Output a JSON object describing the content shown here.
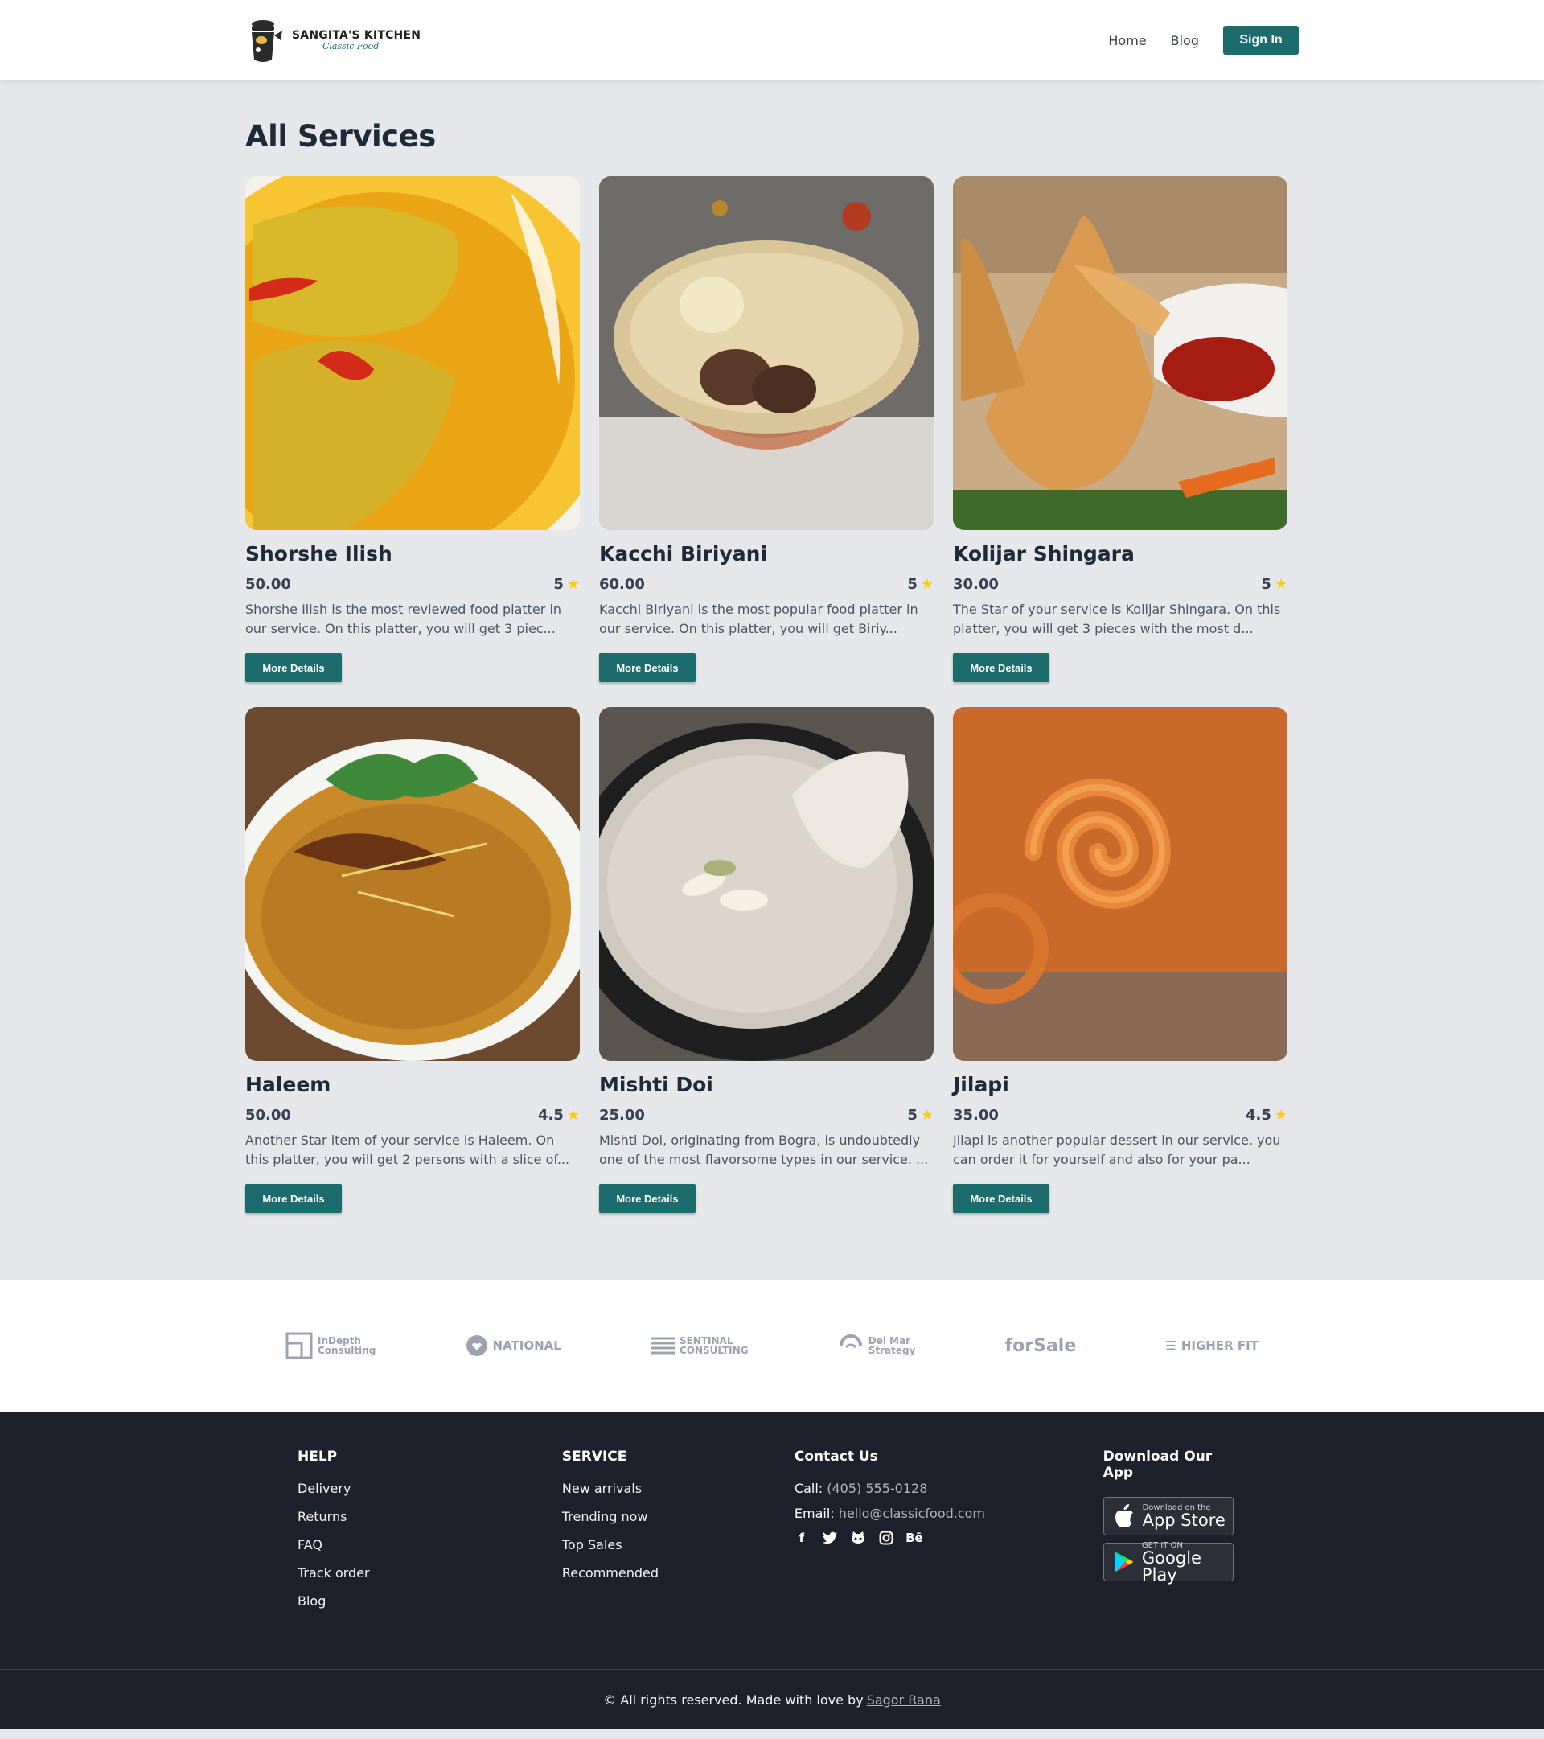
{
  "brand": {
    "name": "SANGITA'S KITCHEN",
    "tagline": "Classic Food"
  },
  "nav": {
    "home": "Home",
    "blog": "Blog",
    "sign_in": "Sign In"
  },
  "page_title": "All Services",
  "services": [
    {
      "title": "Shorshe Ilish",
      "price": "50.00",
      "rating": "5",
      "desc": "Shorshe Ilish is the most reviewed food platter in our service. On this platter, you will get 3 piec...",
      "button": "More Details"
    },
    {
      "title": "Kacchi Biriyani",
      "price": "60.00",
      "rating": "5",
      "desc": "Kacchi Biriyani is the most popular food platter in our service. On this platter, you will get Biriy...",
      "button": "More Details"
    },
    {
      "title": "Kolijar Shingara",
      "price": "30.00",
      "rating": "5",
      "desc": "The Star of your service is Kolijar Shingara. On this platter, you will get 3 pieces with the most d...",
      "button": "More Details"
    },
    {
      "title": "Haleem",
      "price": "50.00",
      "rating": "4.5",
      "desc": "Another Star item of your service is Haleem. On this platter, you will get 2 persons with a slice of...",
      "button": "More Details"
    },
    {
      "title": "Mishti Doi",
      "price": "25.00",
      "rating": "5",
      "desc": "Mishti Doi, originating from Bogra, is undoubtedly one of the most flavorsome types in our service. ...",
      "button": "More Details"
    },
    {
      "title": "Jilapi",
      "price": "35.00",
      "rating": "4.5",
      "desc": "Jilapi is another popular dessert in our service. you can order it for yourself and also for your pa...",
      "button": "More Details"
    }
  ],
  "partners": {
    "indepth": [
      "InDepth",
      "Consulting"
    ],
    "national": "NATIONAL",
    "sentinal": [
      "SENTINAL",
      "CONSULTING"
    ],
    "delmar": [
      "Del Mar",
      "Strategy"
    ],
    "forsale": "forSale",
    "higherfit": "HIGHER FIT"
  },
  "footer": {
    "help_title": "HELP",
    "help_links": [
      "Delivery",
      "Returns",
      "FAQ",
      "Track order",
      "Blog"
    ],
    "service_title": "SERVICE",
    "service_links": [
      "New arrivals",
      "Trending now",
      "Top Sales",
      "Recommended"
    ],
    "contact_title": "Contact Us",
    "call_label": "Call:",
    "call_value": "(405) 555-0128",
    "email_label": "Email:",
    "email_value": "hello@classicfood.com",
    "behance": "Bē",
    "app_title": "Download Our App",
    "appstore_small": "Download on the",
    "appstore_big": "App Store",
    "googleplay_small": "GET IT ON",
    "googleplay_big": "Google Play",
    "copyright": "© All rights reserved. Made with love by",
    "author": "Sagor Rana"
  },
  "icons": [
    "chef-pot-logo-icon",
    "star-icon",
    "facebook-icon",
    "twitter-icon",
    "github-icon",
    "instagram-icon",
    "behance-icon",
    "apple-icon",
    "google-play-icon"
  ],
  "colors": {
    "primary": "#1c6b6d",
    "star": "#facc15",
    "footer_bg": "#1e202b",
    "page_bg": "#e5e7eb"
  }
}
